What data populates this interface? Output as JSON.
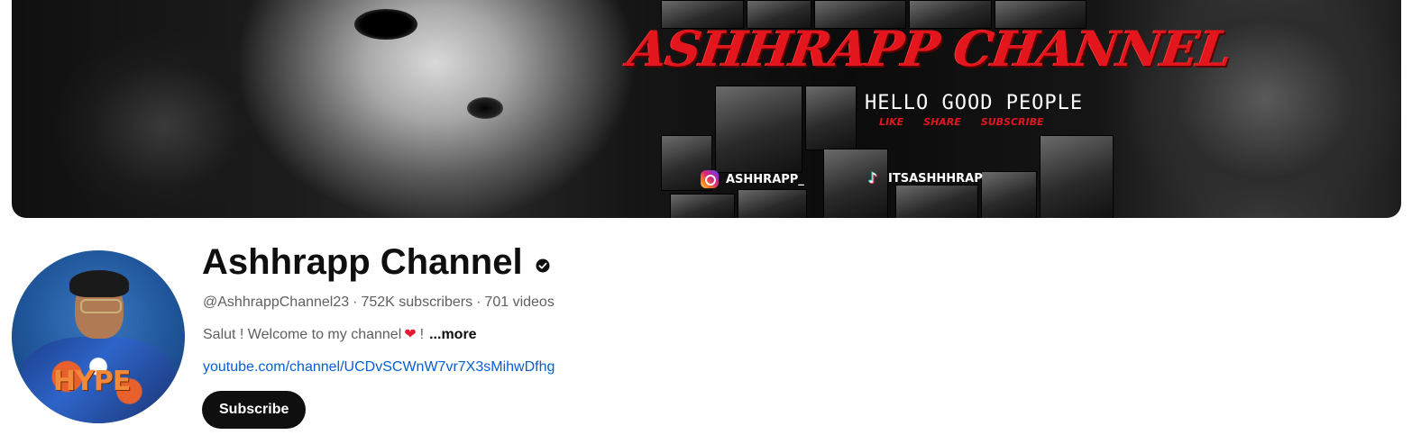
{
  "banner": {
    "title": "ASHHRAPP CHANNEL",
    "greeting": "HELLO GOOD PEOPLE",
    "cta": [
      "LIKE",
      "SHARE",
      "SUBSCRIBE"
    ],
    "instagram_handle": "ASHHRAPP_",
    "tiktok_handle": "ITSASHHHRAP"
  },
  "channel": {
    "name": "Ashhrapp Channel",
    "handle": "@AshhrappChannel23",
    "separator": "·",
    "subscribers": "752K subscribers",
    "videos": "701 videos",
    "description_text": "Salut  ! Welcome to my channel",
    "description_tail": "!",
    "heart": "❤",
    "more_label": "...more",
    "link": "youtube.com/channel/UCDvSCWnW7vr7X3sMihwDfhg",
    "subscribe_label": "Subscribe",
    "avatar_shirt_text": "HYPE"
  },
  "colors": {
    "link": "#065fd4",
    "subscribe_bg": "#0f0f0f",
    "banner_accent": "#e2161c"
  },
  "icons": {
    "verified": "verified-check-icon",
    "instagram": "instagram-icon",
    "tiktok": "tiktok-icon"
  }
}
